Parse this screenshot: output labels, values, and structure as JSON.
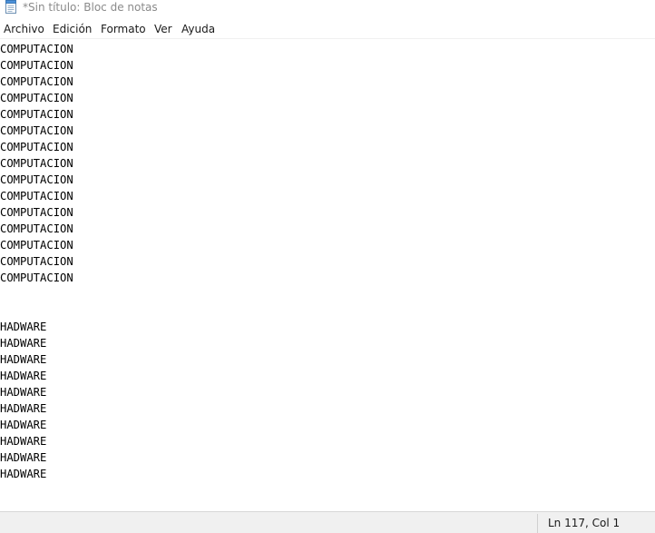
{
  "window": {
    "title": "*Sin título: Bloc de notas",
    "icon": "notepad-icon"
  },
  "menu": {
    "items": [
      "Archivo",
      "Edición",
      "Formato",
      "Ver",
      "Ayuda"
    ]
  },
  "editor": {
    "text": "COMPUTACION\nCOMPUTACION\nCOMPUTACION\nCOMPUTACION\nCOMPUTACION\nCOMPUTACION\nCOMPUTACION\nCOMPUTACION\nCOMPUTACION\nCOMPUTACION\nCOMPUTACION\nCOMPUTACION\nCOMPUTACION\nCOMPUTACION\nCOMPUTACION\n\n\nHADWARE\nHADWARE\nHADWARE\nHADWARE\nHADWARE\nHADWARE\nHADWARE\nHADWARE\nHADWARE\nHADWARE"
  },
  "status": {
    "position": "Ln 117, Col 1"
  }
}
